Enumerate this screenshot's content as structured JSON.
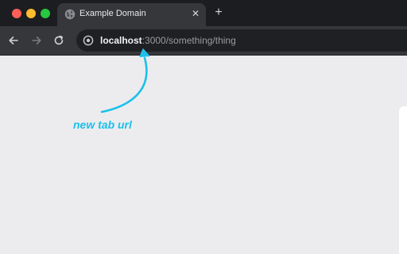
{
  "window": {
    "traffic_lights": [
      "close",
      "minimize",
      "maximize"
    ]
  },
  "tab": {
    "title": "Example Domain",
    "favicon_icon": "globe-icon",
    "close_label": "✕"
  },
  "new_tab": {
    "label": "+"
  },
  "toolbar": {
    "back_icon": "arrow-left-icon",
    "forward_icon": "arrow-right-icon",
    "reload_icon": "reload-icon"
  },
  "omnibox": {
    "host": "localhost",
    "rest": ":3000/something/thing",
    "site_icon": "site-info-icon"
  },
  "annotation": {
    "text": "new tab url",
    "color": "#1ec0ea"
  },
  "colors": {
    "tabstrip_bg": "#1c1d20",
    "tab_bg": "#36373b",
    "omnibox_bg": "#1f2023",
    "content_bg": "#ececef"
  }
}
